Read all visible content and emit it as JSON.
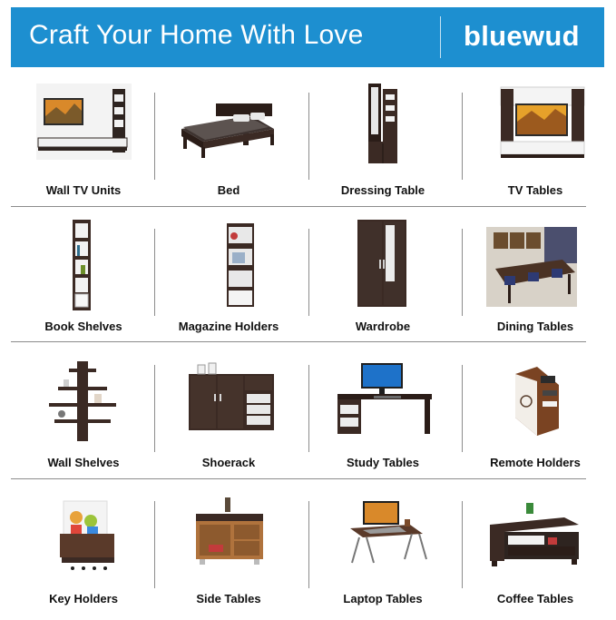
{
  "banner": {
    "title": "Craft Your Home With Love",
    "brand": "bluewud",
    "background_color": "#1d8fd0"
  },
  "colors": {
    "wood_dark": "#3b2a24",
    "wood_light": "#b0733d",
    "screen": "#e08a2a",
    "accent_white": "#f2f2f2"
  },
  "categories": [
    {
      "label": "Wall TV Units",
      "icon": "wall-tv-unit-icon"
    },
    {
      "label": "Bed",
      "icon": "bed-icon"
    },
    {
      "label": "Dressing Table",
      "icon": "dressing-table-icon"
    },
    {
      "label": "TV Tables",
      "icon": "tv-table-icon"
    },
    {
      "label": "Book Shelves",
      "icon": "book-shelf-icon"
    },
    {
      "label": "Magazine Holders",
      "icon": "magazine-holder-icon"
    },
    {
      "label": "Wardrobe",
      "icon": "wardrobe-icon"
    },
    {
      "label": "Dining Tables",
      "icon": "dining-table-icon"
    },
    {
      "label": "Wall Shelves",
      "icon": "wall-shelves-icon"
    },
    {
      "label": "Shoerack",
      "icon": "shoerack-icon"
    },
    {
      "label": "Study Tables",
      "icon": "study-table-icon"
    },
    {
      "label": "Remote Holders",
      "icon": "remote-holder-icon"
    },
    {
      "label": "Key Holders",
      "icon": "key-holder-icon"
    },
    {
      "label": "Side Tables",
      "icon": "side-table-icon"
    },
    {
      "label": "Laptop Tables",
      "icon": "laptop-table-icon"
    },
    {
      "label": "Coffee Tables",
      "icon": "coffee-table-icon"
    }
  ]
}
